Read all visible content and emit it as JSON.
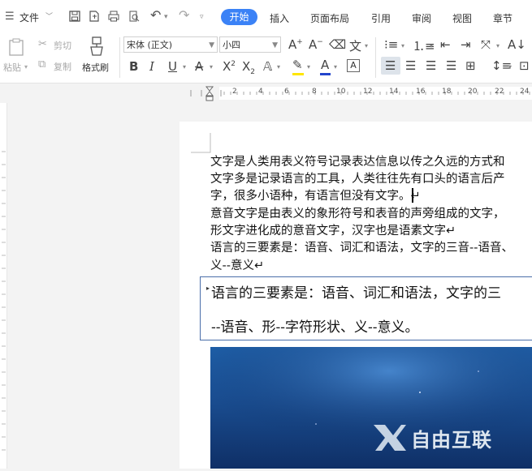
{
  "menubar": {
    "file_label": "文件",
    "tabs": [
      "开始",
      "插入",
      "页面布局",
      "引用",
      "审阅",
      "视图",
      "章节"
    ],
    "active_tab": "开始"
  },
  "ribbon": {
    "paste_label": "粘贴",
    "cut_label": "剪切",
    "copy_label": "复制",
    "format_painter_label": "格式刷",
    "font_family": "宋体 (正文)",
    "font_size": "小四",
    "font_color": "#cc2222",
    "highlight_color": "#ffe600",
    "underline_color": "#2244cc"
  },
  "ruler": {
    "ticks": [
      "2",
      "4",
      "6",
      "8",
      "10",
      "12",
      "14",
      "16",
      "18",
      "20",
      "22",
      "24"
    ]
  },
  "document": {
    "lines": [
      "文字是人类用表义符号记录表达信息以传之久远的方式和",
      "文字多是记录语言的工具，人类往往先有口头的语言后产",
      "字，很多小语种，有语言但没有文字。↵",
      "意音文字是由表义的象形符号和表音的声旁组成的文字，",
      "形文字进化成的意音文字，汉字也是语素文字↵",
      "语言的三要素是：语音、词汇和语法，文字的三音--语音、",
      "义--意义↵"
    ],
    "textbox_lines": [
      "语言的三要素是：语音、词汇和语法，文字的三",
      "--语音、形--字符形状、义--意义。"
    ]
  },
  "watermark": {
    "logo_text": "自由互联"
  }
}
